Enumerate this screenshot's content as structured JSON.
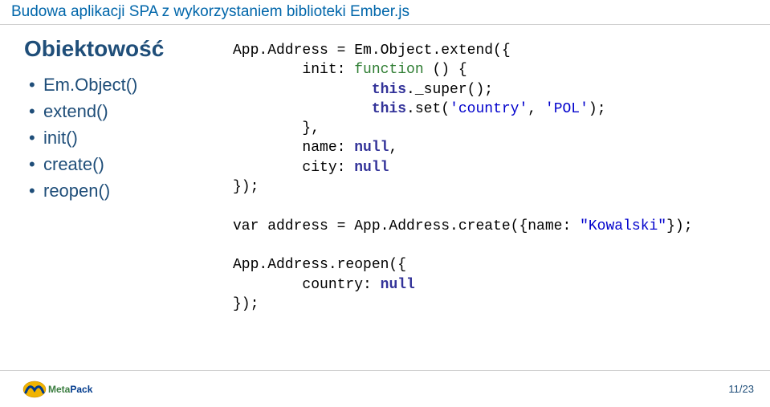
{
  "header": {
    "title": "Budowa aplikacji SPA z wykorzystaniem biblioteki Ember.js"
  },
  "left": {
    "topic": "Obiektowość",
    "bullets": [
      "Em.Object()",
      "extend()",
      "init()",
      "create()",
      "reopen()"
    ]
  },
  "code": {
    "l01a": "App.Address = Em.Object.extend({",
    "l02a": "        init: ",
    "l02b": "function",
    "l02c": " () {",
    "l03a": "                ",
    "l03b": "this",
    "l03c": "._super();",
    "l04a": "                ",
    "l04b": "this",
    "l04c": ".set(",
    "l04d": "'country'",
    "l04e": ", ",
    "l04f": "'POL'",
    "l04g": ");",
    "l05": "        },",
    "l06a": "        name: ",
    "l06b": "null",
    "l06c": ",",
    "l07a": "        city: ",
    "l07b": "null",
    "l08": "});",
    "l10a": "var address = App.Address.create({name: ",
    "l10b": "\"Kowalski\"",
    "l10c": "});",
    "l12": "App.Address.reopen({",
    "l13a": "        country: ",
    "l13b": "null",
    "l14": "});"
  },
  "footer": {
    "logo_meta": "Meta",
    "logo_pack": "Pack",
    "page": "11/23"
  }
}
